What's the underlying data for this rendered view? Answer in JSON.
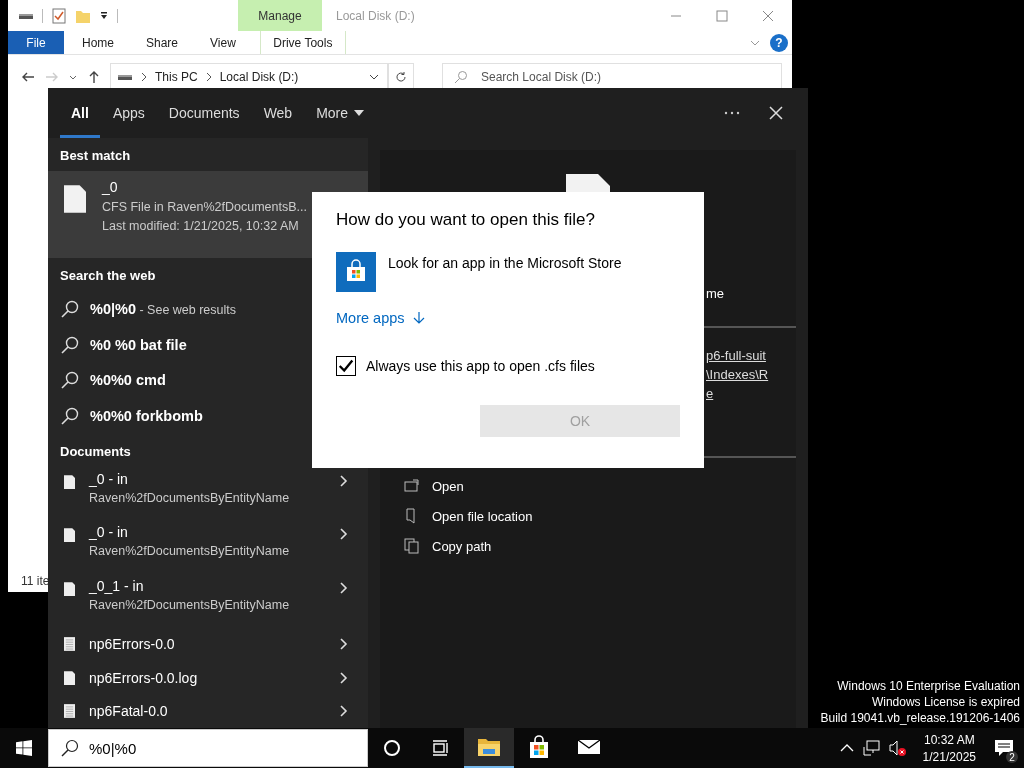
{
  "explorer": {
    "contextual_group": "Manage",
    "title": "Local Disk (D:)",
    "ribbon_tabs": [
      {
        "label": "File",
        "kind": "file"
      },
      {
        "label": "Home",
        "kind": "tab"
      },
      {
        "label": "Share",
        "kind": "tab"
      },
      {
        "label": "View",
        "kind": "tab"
      },
      {
        "label": "Drive Tools",
        "kind": "contextual"
      }
    ],
    "help_glyph": "?",
    "breadcrumb": [
      "This PC",
      "Local Disk (D:)"
    ],
    "search_placeholder": "Search Local Disk (D:)",
    "status": "11 ite"
  },
  "search": {
    "tabs": [
      {
        "label": "All",
        "selected": true,
        "dropdown": false
      },
      {
        "label": "Apps",
        "selected": false,
        "dropdown": false
      },
      {
        "label": "Documents",
        "selected": false,
        "dropdown": false
      },
      {
        "label": "Web",
        "selected": false,
        "dropdown": false
      },
      {
        "label": "More",
        "selected": false,
        "dropdown": true
      }
    ],
    "best_match_heading": "Best match",
    "best_match": {
      "name": "_0",
      "location": "CFS File in Raven%2fDocumentsB...",
      "modified": "Last modified: 1/21/2025, 10:32 AM",
      "selected": true
    },
    "web_heading": "Search the web",
    "web_results": [
      {
        "query": "%0|%0",
        "suffix": " - See web results"
      },
      {
        "query": "%0 %0 bat file"
      },
      {
        "query": "%0%0 cmd"
      },
      {
        "query": "%0%0 forkbomb"
      }
    ],
    "documents_heading": "Documents",
    "documents": [
      {
        "name": "_0 - in",
        "path": "Raven%2fDocumentsByEntityName",
        "kind": "blank"
      },
      {
        "name": "_0 - in",
        "path": "Raven%2fDocumentsByEntityName",
        "kind": "blank"
      },
      {
        "name": "_0_1 - in",
        "path": "Raven%2fDocumentsByEntityName",
        "kind": "blank"
      },
      {
        "name": "np6Errors-0.0",
        "kind": "text"
      },
      {
        "name": "np6Errors-0.0.log",
        "kind": "blank"
      },
      {
        "name": "np6Fatal-0.0",
        "kind": "text"
      }
    ],
    "query": "%0|%0"
  },
  "preview": {
    "title_fragment": "me",
    "link_fragments": [
      "p6-full-suit",
      "\\Indexes\\R",
      "e"
    ],
    "actions": [
      {
        "label": "Open",
        "kind": "open"
      },
      {
        "label": "Open file location",
        "kind": "location"
      },
      {
        "label": "Copy path",
        "kind": "copy"
      }
    ]
  },
  "dialog": {
    "title": "How do you want to open this file?",
    "store_option": "Look for an app in the Microsoft Store",
    "more_apps": "More apps",
    "always_use": {
      "label": "Always use this app to open .cfs files",
      "checked": true
    },
    "ok": {
      "label": "OK",
      "disabled": true
    }
  },
  "desktop_notice": [
    "Windows 10 Enterprise Evaluation",
    "Windows License is expired",
    "Build 19041.vb_release.191206-1406"
  ],
  "taskbar": {
    "apps": [
      {
        "kind": "explorer",
        "active": true
      },
      {
        "kind": "store",
        "active": false
      },
      {
        "kind": "mail",
        "active": false
      }
    ],
    "time": "10:32 AM",
    "date": "1/21/2025",
    "notification_count": "2"
  }
}
